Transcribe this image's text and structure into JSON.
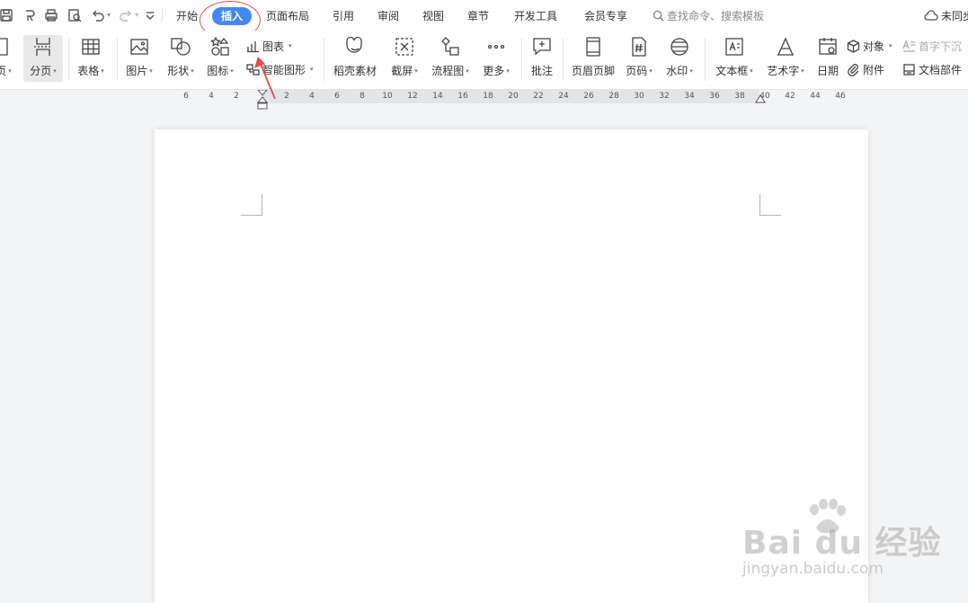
{
  "menu": {
    "tabs": [
      {
        "label": "开始"
      },
      {
        "label": "插入",
        "active": true
      },
      {
        "label": "页面布局"
      },
      {
        "label": "引用"
      },
      {
        "label": "审阅"
      },
      {
        "label": "视图"
      },
      {
        "label": "章节"
      },
      {
        "label": "开发工具"
      },
      {
        "label": "会员专享"
      }
    ],
    "search_placeholder": "查找命令、搜索模板",
    "sync_status": "未同步"
  },
  "ribbon": {
    "cover_page": "页",
    "page_break": "分页",
    "table": "表格",
    "picture": "图片",
    "shape": "形状",
    "icons": "图标",
    "chart": "图表",
    "smart_art": "智能图形",
    "docer_material": "稻壳素材",
    "screenshot": "截屏",
    "flowchart": "流程图",
    "more": "更多",
    "comment": "批注",
    "header_footer": "页眉页脚",
    "page_number": "页码",
    "watermark": "水印",
    "text_box": "文本框",
    "word_art": "艺术字",
    "date": "日期",
    "object": "对象",
    "attachment": "附件",
    "drop_cap": "首字下沉",
    "doc_parts": "文档部件"
  },
  "ruler": {
    "ticks": [
      "6",
      "4",
      "2",
      "2",
      "4",
      "6",
      "8",
      "10",
      "12",
      "14",
      "16",
      "18",
      "20",
      "22",
      "24",
      "26",
      "28",
      "30",
      "32",
      "34",
      "36",
      "38",
      "40",
      "42",
      "44",
      "46"
    ]
  },
  "watermark": {
    "logo_text": "Bai du 经验",
    "url": "jingyan.baidu.com"
  },
  "colors": {
    "accent": "#4287f5",
    "annotation": "#e84a4a",
    "canvas_bg": "#f3f4f6"
  }
}
